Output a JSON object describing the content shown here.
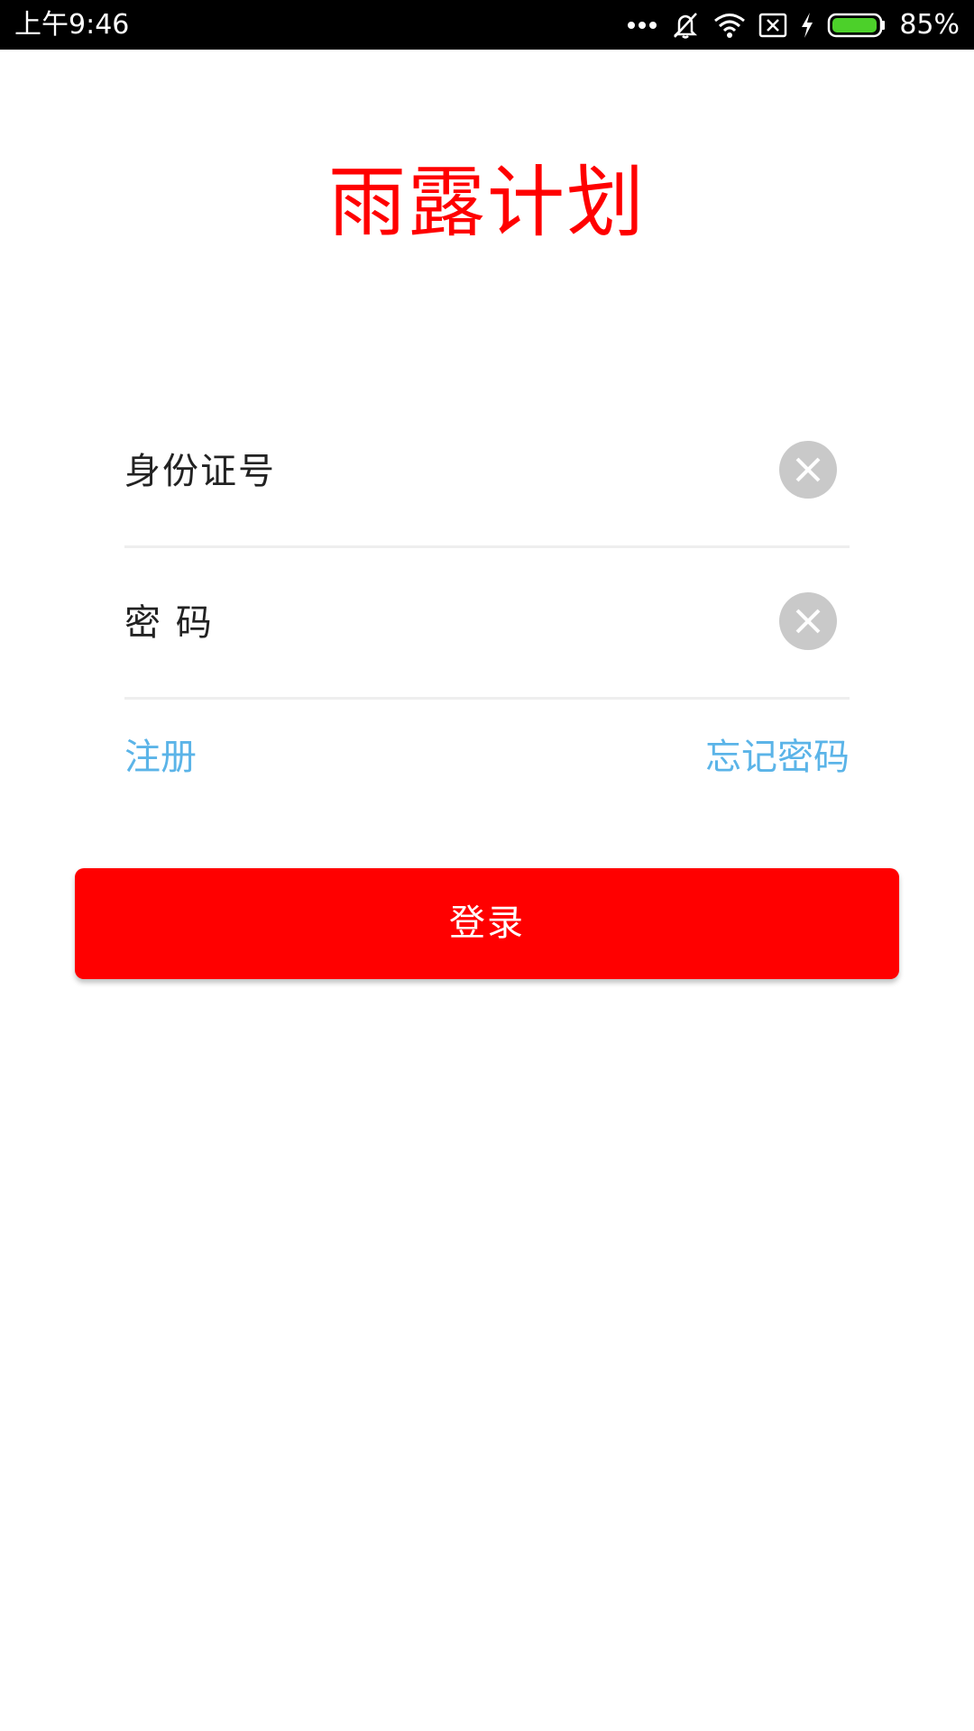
{
  "status_bar": {
    "time": "上午9:46",
    "battery_percent": "85%",
    "battery_level": 0.85,
    "icons": [
      "more-dots-icon",
      "mute-icon",
      "wifi-icon",
      "sim-x-icon",
      "charging-icon",
      "battery-icon"
    ]
  },
  "app": {
    "title": "雨露计划"
  },
  "form": {
    "id_label": "身份证号",
    "id_value": "",
    "password_label": "密 码",
    "password_value": ""
  },
  "links": {
    "register": "注册",
    "forgot_password": "忘记密码"
  },
  "login_button": {
    "label": "登录"
  },
  "colors": {
    "brand_red": "#ff0000",
    "link_blue": "#5bb4e8",
    "clear_gray": "#c9c9c9",
    "battery_green": "#4cd02a"
  }
}
